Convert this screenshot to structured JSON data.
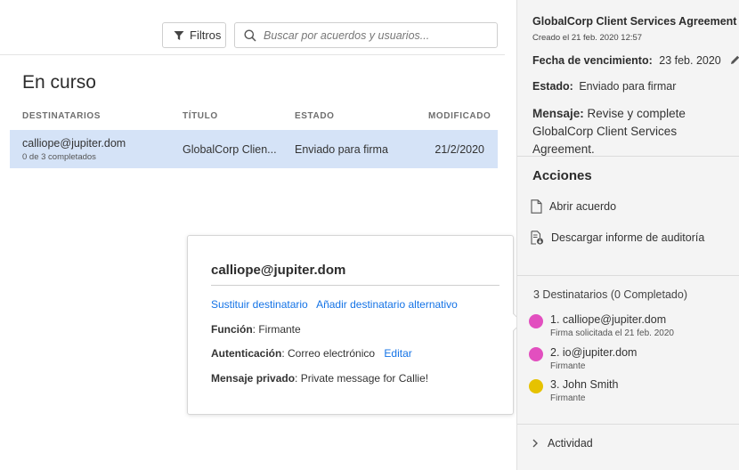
{
  "toolbar": {
    "filters_label": "Filtros",
    "search_placeholder": "Buscar por acuerdos y usuarios..."
  },
  "list": {
    "section_title": "En curso",
    "columns": {
      "recipients": "DESTINATARIOS",
      "title": "TÍTULO",
      "status": "ESTADO",
      "modified": "MODIFICADO"
    },
    "rows": [
      {
        "recipient": "calliope@jupiter.dom",
        "progress": "0 de 3 completados",
        "title": "GlobalCorp Clien...",
        "status": "Enviado para firma",
        "modified": "21/2/2020"
      }
    ]
  },
  "popover": {
    "email": "calliope@jupiter.dom",
    "replace_link": "Sustituir destinatario",
    "add_alt_link": "Añadir destinatario alternativo",
    "role_label": "Función",
    "role_value": "Firmante",
    "auth_label": "Autenticación",
    "auth_value": "Correo electrónico",
    "edit_link": "Editar",
    "private_label": "Mensaje privado",
    "private_value": "Private message for Callie!"
  },
  "details": {
    "title": "GlobalCorp Client Services Agreement",
    "created": "Creado el 21 feb. 2020 12:57",
    "expiration_label": "Fecha de vencimiento:",
    "expiration_value": "23 feb. 2020",
    "status_label": "Estado:",
    "status_value": "Enviado para firmar",
    "message_label": "Mensaje:",
    "message_value": "Revise y complete GlobalCorp Client Services Agreement.",
    "actions_heading": "Acciones",
    "action_open": "Abrir acuerdo",
    "action_download": "Descargar informe de auditoría",
    "recipients_heading": "3 Destinatarios (0 Completado)",
    "recipients": [
      {
        "name": "1. calliope@jupiter.dom",
        "sub": "Firma solicitada el 21 feb. 2020",
        "color": "#e24fbf"
      },
      {
        "name": "2. io@jupiter.dom",
        "sub": "Firmante",
        "color": "#e24fbf"
      },
      {
        "name": "3. John Smith",
        "sub": "Firmante",
        "color": "#e6c200"
      }
    ],
    "activity_label": "Actividad"
  },
  "colors": {
    "accent": "#1473e6",
    "selected_row": "#d5e3f7",
    "right_panel": "#f4f4f4"
  }
}
